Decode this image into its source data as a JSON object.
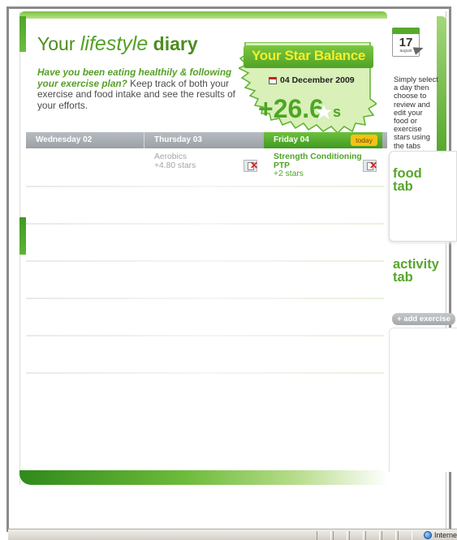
{
  "diary": {
    "title_prefix": "Your",
    "title_italic": "lifestyle",
    "title_suffix": "diary",
    "intro_question": "Have you been eating healthily & following your exercise plan?",
    "intro_text": " Keep track of both your exercise and food intake and see the results of your efforts."
  },
  "star_balance": {
    "title": "Your Star Balance",
    "date": "04 December 2009",
    "value": "+26.6",
    "unit_suffix": "s"
  },
  "calendar_icon": {
    "day": "17",
    "month": "august"
  },
  "hint_text": "Simply select a day then choose to review and edit your food or exercise stars using the tabs below",
  "days": [
    {
      "label": "Wednesday 02"
    },
    {
      "label": "Thursday 03"
    },
    {
      "label": "Friday 04",
      "badge": "today"
    }
  ],
  "entries": [
    {
      "day": "Thursday 03",
      "name": "Aerobics",
      "points": "+4.80 stars"
    },
    {
      "day": "Friday 04",
      "name_line1": "Strength Conditioning",
      "name_line2": "PTP",
      "points": "+2 stars"
    }
  ],
  "tabs": {
    "food": {
      "line1": "food",
      "line2": "tab"
    },
    "activity": {
      "line1": "activity",
      "line2": "tab"
    },
    "add_exercise": "+ add exercise"
  },
  "statusbar": {
    "zone": "Internet"
  },
  "colors": {
    "brand_green": "#4ea526",
    "star_yellow": "#f5ef2a",
    "today_badge": "#f5c213",
    "header_gray": "#9aa1a6"
  }
}
